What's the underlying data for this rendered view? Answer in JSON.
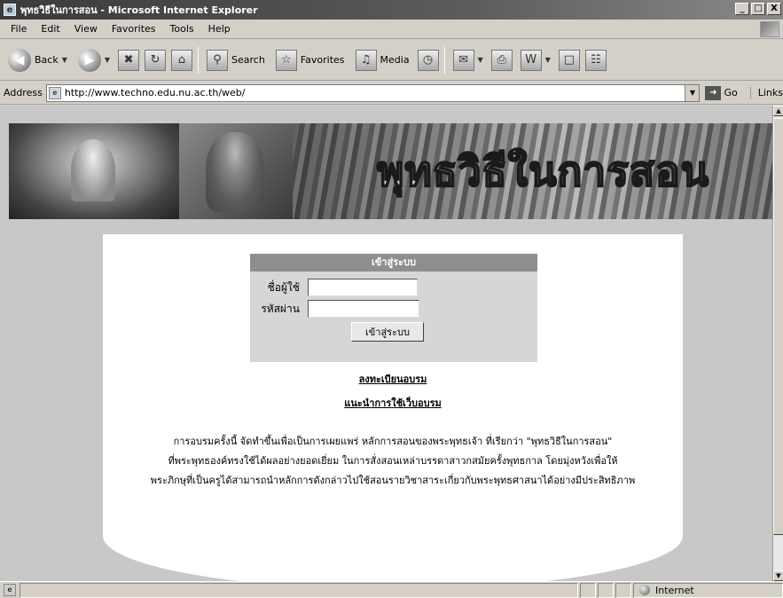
{
  "window": {
    "title": "พุทธวิธีในการสอน - Microsoft Internet Explorer",
    "buttons": [
      "_",
      "□",
      "X"
    ]
  },
  "menu": [
    "File",
    "Edit",
    "View",
    "Favorites",
    "Tools",
    "Help"
  ],
  "toolbar": {
    "back_label": "Back",
    "search_label": "Search",
    "favorites_label": "Favorites",
    "media_label": "Media"
  },
  "address": {
    "label": "Address",
    "url": "http://www.techno.edu.nu.ac.th/web/",
    "go_label": "Go",
    "links_label": "Links"
  },
  "banner": {
    "title": "พุทธวิธีในการสอน"
  },
  "login": {
    "header": "เข้าสู่ระบบ",
    "username_label": "ชื่อผู้ใช้",
    "username_value": "",
    "password_label": "รหัสผ่าน",
    "password_value": "",
    "submit_label": "เข้าสู่ระบบ"
  },
  "links": {
    "register": "ลงทะเบียนอบรม",
    "guide": "แนะนำการใช้เว็บอบรม"
  },
  "description": [
    "การอบรมครั้งนี้ จัดทำขึ้นเพื่อเป็นการเผยแพร่ หลักการสอนของพระพุทธเจ้า ที่เรียกว่า \"พุทธวิธีในการสอน\"",
    "ที่พระพุทธองค์ทรงใช้ได้ผลอย่างยอดเยี่ยม ในการสั่งสอนเหล่าบรรดาสาวกสมัยครั้งพุทธกาล โดยมุ่งหวังเพื่อให้",
    "พระภิกษุที่เป็นครูได้สามารถนำหลักการดังกล่าวไปใช้สอนรายวิชาสาระเกี่ยวกับพระพุทธศาสนาได้อย่างมีประสิทธิภาพ"
  ],
  "status": {
    "zone": "Internet"
  }
}
